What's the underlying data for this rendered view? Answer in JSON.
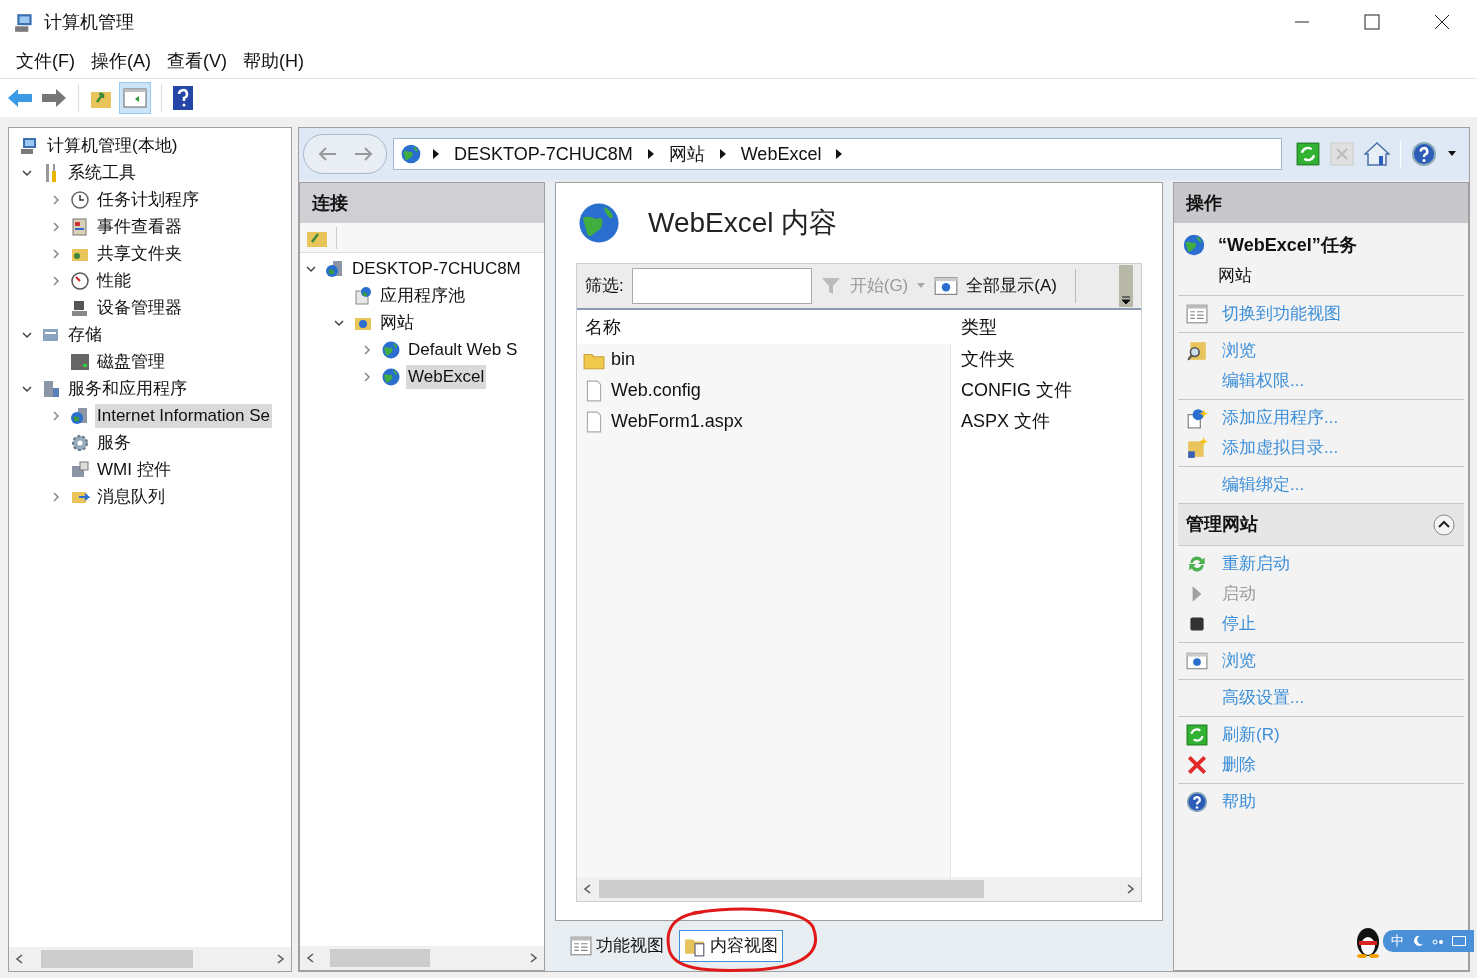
{
  "window": {
    "title": "计算机管理"
  },
  "menu": [
    "文件(F)",
    "操作(A)",
    "查看(V)",
    "帮助(H)"
  ],
  "tree": [
    {
      "label": "计算机管理(本地)",
      "kind": "computer",
      "selected": false,
      "children": [
        {
          "label": "系统工具",
          "kind": "tools",
          "expanded": true,
          "selected": false,
          "children": [
            {
              "label": "任务计划程序",
              "kind": "clock",
              "expanded": false,
              "selected": false
            },
            {
              "label": "事件查看器",
              "kind": "log",
              "expanded": false,
              "selected": false
            },
            {
              "label": "共享文件夹",
              "kind": "share",
              "expanded": false,
              "selected": false
            },
            {
              "label": "性能",
              "kind": "gauge",
              "expanded": false,
              "selected": false
            },
            {
              "label": "设备管理器",
              "kind": "device",
              "selected": false
            }
          ]
        },
        {
          "label": "存储",
          "kind": "storage",
          "expanded": true,
          "selected": false,
          "children": [
            {
              "label": "磁盘管理",
              "kind": "disk",
              "selected": false
            }
          ]
        },
        {
          "label": "服务和应用程序",
          "kind": "apps",
          "expanded": true,
          "selected": false,
          "children": [
            {
              "label": "Internet Information Se",
              "kind": "server",
              "expanded": false,
              "selected": true
            },
            {
              "label": "服务",
              "kind": "gear",
              "selected": false
            },
            {
              "label": "WMI 控件",
              "kind": "wmi",
              "selected": false
            },
            {
              "label": "消息队列",
              "kind": "queue",
              "expanded": false,
              "selected": false
            }
          ]
        }
      ]
    }
  ],
  "breadcrumb": [
    "DESKTOP-7CHUC8M",
    "网站",
    "WebExcel"
  ],
  "connections": {
    "title": "连接",
    "tree": [
      {
        "label": "DESKTOP-7CHUC8M",
        "kind": "server",
        "expanded": true,
        "selected": false,
        "children": [
          {
            "label": "应用程序池",
            "kind": "pool",
            "selected": false
          },
          {
            "label": "网站",
            "kind": "sites",
            "expanded": true,
            "selected": false,
            "children": [
              {
                "label": "Default Web S",
                "kind": "globe",
                "expanded": false,
                "selected": false
              },
              {
                "label": "WebExcel",
                "kind": "globe",
                "expanded": false,
                "selected": true
              }
            ]
          }
        ]
      }
    ]
  },
  "content": {
    "title": "WebExcel 内容",
    "filter": {
      "label": "筛选:",
      "start": "开始(G)",
      "start_disabled": true,
      "show_all": "全部显示(A)"
    },
    "columns": [
      "名称",
      "类型"
    ],
    "rows": [
      {
        "name": "bin",
        "type": "文件夹",
        "kind": "folder"
      },
      {
        "name": "Web.config",
        "type": "CONFIG 文件",
        "kind": "file"
      },
      {
        "name": "WebForm1.aspx",
        "type": "ASPX 文件",
        "kind": "file"
      }
    ],
    "view_tabs": [
      {
        "label": "功能视图",
        "selected": false,
        "kind": "features"
      },
      {
        "label": "内容视图",
        "selected": true,
        "kind": "content"
      }
    ]
  },
  "actions": {
    "title": "操作",
    "task_title": "“WebExcel”任务",
    "task_subtitle": "网站",
    "groups": [
      [
        {
          "label": "切换到功能视图",
          "kind": "features",
          "disabled": false
        }
      ],
      [
        {
          "label": "浏览",
          "kind": "browse",
          "disabled": false
        },
        {
          "label": "编辑权限...",
          "kind": "none",
          "disabled": false
        }
      ],
      [
        {
          "label": "添加应用程序...",
          "kind": "addapp",
          "disabled": false
        },
        {
          "label": "添加虚拟目录...",
          "kind": "adddir",
          "disabled": false
        }
      ],
      [
        {
          "label": "编辑绑定...",
          "kind": "none",
          "disabled": false
        }
      ]
    ],
    "section": {
      "title": "管理网站",
      "expanded": true,
      "groups": [
        [
          {
            "label": "重新启动",
            "kind": "restart",
            "disabled": false
          },
          {
            "label": "启动",
            "kind": "play",
            "disabled": true
          },
          {
            "label": "停止",
            "kind": "stop",
            "disabled": false
          }
        ],
        [
          {
            "label": "浏览",
            "kind": "browsewin",
            "disabled": false
          }
        ],
        [
          {
            "label": "高级设置...",
            "kind": "none",
            "disabled": false
          }
        ]
      ]
    },
    "tail": [
      [
        {
          "label": "刷新(R)",
          "kind": "refresh",
          "disabled": false
        },
        {
          "label": "删除",
          "kind": "delete",
          "disabled": false
        }
      ],
      [
        {
          "label": "帮助",
          "kind": "help",
          "disabled": false
        }
      ]
    ]
  },
  "ime": {
    "mode": "中"
  }
}
